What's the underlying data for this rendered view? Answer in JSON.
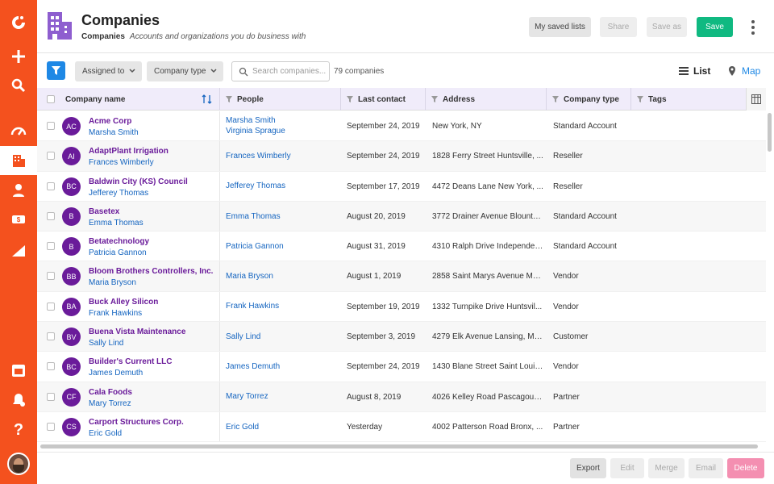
{
  "header": {
    "title": "Companies",
    "breadcrumb": "Companies",
    "subtitle": "Accounts and organizations you do business with",
    "buttons": {
      "saved_lists": "My saved lists",
      "share": "Share",
      "save_as": "Save as",
      "save": "Save"
    }
  },
  "toolbar": {
    "assigned_to": "Assigned to",
    "company_type": "Company type",
    "search_placeholder": "Search companies...",
    "count": "79 companies",
    "view_list": "List",
    "view_map": "Map"
  },
  "table": {
    "columns": {
      "company_name": "Company name",
      "people": "People",
      "last_contact": "Last contact",
      "address": "Address",
      "company_type": "Company type",
      "tags": "Tags"
    },
    "rows": [
      {
        "initials": "AC",
        "name": "Acme Corp",
        "contact": "Marsha Smith",
        "people": [
          "Marsha Smith",
          "Virginia Sprague"
        ],
        "last_contact": "September 24, 2019",
        "address": "New York, NY",
        "type": "Standard Account"
      },
      {
        "initials": "AI",
        "name": "AdaptPlant Irrigation",
        "contact": "Frances Wimberly",
        "people": [
          "Frances Wimberly"
        ],
        "last_contact": "September 24, 2019",
        "address": "1828 Ferry Street Huntsville, ...",
        "type": "Reseller"
      },
      {
        "initials": "BC",
        "name": "Baldwin City (KS) Council",
        "contact": "Jefferey Thomas",
        "people": [
          "Jefferey Thomas"
        ],
        "last_contact": "September 17, 2019",
        "address": "4472 Deans Lane New York, ...",
        "type": "Reseller"
      },
      {
        "initials": "B",
        "name": "Basetex",
        "contact": "Emma Thomas",
        "people": [
          "Emma Thomas"
        ],
        "last_contact": "August 20, 2019",
        "address": "3772 Drainer Avenue Blounts...",
        "type": "Standard Account"
      },
      {
        "initials": "B",
        "name": "Betatechnology",
        "contact": "Patricia Gannon",
        "people": [
          "Patricia Gannon"
        ],
        "last_contact": "August 31, 2019",
        "address": "4310 Ralph Drive Independen...",
        "type": "Standard Account"
      },
      {
        "initials": "BB",
        "name": "Bloom Brothers Controllers, Inc.",
        "contact": "Maria Bryson",
        "people": [
          "Maria Bryson"
        ],
        "last_contact": "August 1, 2019",
        "address": "2858 Saint Marys Avenue Ma...",
        "type": "Vendor"
      },
      {
        "initials": "BA",
        "name": "Buck Alley Silicon",
        "contact": "Frank Hawkins",
        "people": [
          "Frank Hawkins"
        ],
        "last_contact": "September 19, 2019",
        "address": "1332 Turnpike Drive Huntsvil...",
        "type": "Vendor"
      },
      {
        "initials": "BV",
        "name": "Buena Vista Maintenance",
        "contact": "Sally Lind",
        "people": [
          "Sally Lind"
        ],
        "last_contact": "September 3, 2019",
        "address": "4279 Elk Avenue Lansing, Mic...",
        "type": "Customer"
      },
      {
        "initials": "BC",
        "name": "Builder's Current LLC",
        "contact": "James Demuth",
        "people": [
          "James Demuth"
        ],
        "last_contact": "September 24, 2019",
        "address": "1430 Blane Street Saint Louis,...",
        "type": "Vendor"
      },
      {
        "initials": "CF",
        "name": "Cala Foods",
        "contact": "Mary Torrez",
        "people": [
          "Mary Torrez"
        ],
        "last_contact": "August 8, 2019",
        "address": "4026 Kelley Road Pascagoula,...",
        "type": "Partner"
      },
      {
        "initials": "CS",
        "name": "Carport Structures Corp.",
        "contact": "Eric Gold",
        "people": [
          "Eric Gold"
        ],
        "last_contact": "Yesterday",
        "address": "4002 Patterson Road Bronx, ...",
        "type": "Partner"
      }
    ]
  },
  "footer": {
    "export": "Export",
    "edit": "Edit",
    "merge": "Merge",
    "email": "Email",
    "delete": "Delete"
  },
  "sidebar": {
    "icons": [
      "logo-icon",
      "add-icon",
      "search-icon",
      "dashboard-icon",
      "companies-icon",
      "people-icon",
      "deals-icon",
      "reports-icon",
      "calendar-icon",
      "notifications-icon",
      "help-icon"
    ]
  },
  "colors": {
    "sidebar": "#f4511e",
    "accent_purple": "#6a1b9a",
    "link_blue": "#1565c0",
    "save_green": "#10b981",
    "delete_pink": "#f48fb1",
    "header_row": "#f0ecfa"
  }
}
